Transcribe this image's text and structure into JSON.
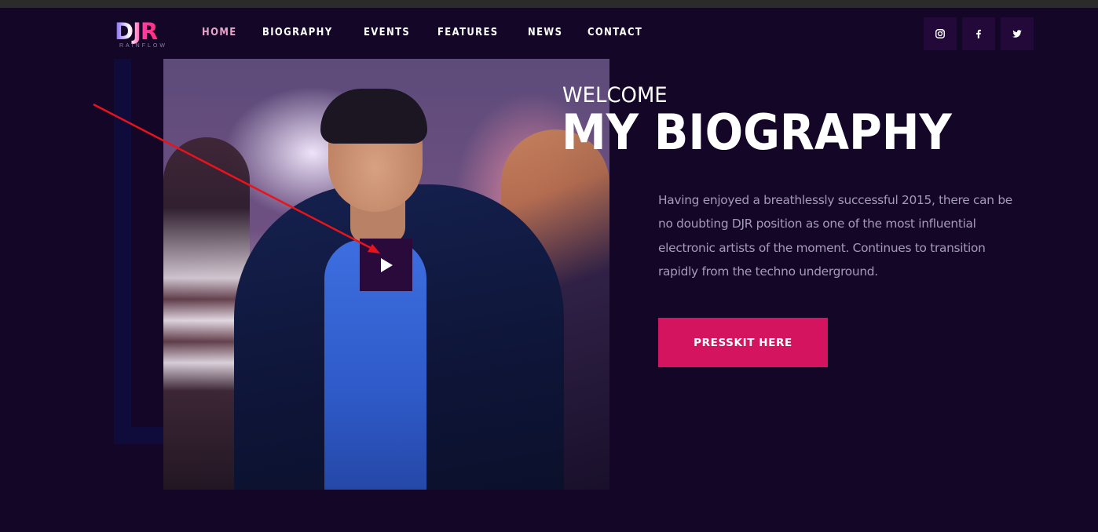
{
  "header": {
    "logo": {
      "mark": "DJR",
      "sub": "RAINFLOW"
    },
    "nav": [
      {
        "label": "HOME",
        "active": true
      },
      {
        "label": "BIOGRAPHY",
        "active": false
      },
      {
        "label": "EVENTS",
        "active": false
      },
      {
        "label": "FEATURES",
        "active": false
      },
      {
        "label": "NEWS",
        "active": false
      },
      {
        "label": "CONTACT",
        "active": false
      }
    ],
    "social": [
      "instagram-icon",
      "facebook-icon",
      "twitter-icon"
    ]
  },
  "hero": {
    "eyebrow": "WELCOME",
    "title": "MY BIOGRAPHY",
    "bio": "Having enjoyed a breathlessly successful 2015, there can be no doubting DJR position as one of the most influential electronic artists of the moment. Continues to transition rapidly from the techno underground.",
    "cta_label": "PRESSKIT HERE",
    "play_icon": "play-icon"
  },
  "colors": {
    "background": "#140627",
    "nav_active": "#e7a2c8",
    "social_bg": "#22093a",
    "cta_bg": "#d4145f",
    "bio_text": "#a59bb8",
    "annotation_arrow": "#e8131b"
  }
}
